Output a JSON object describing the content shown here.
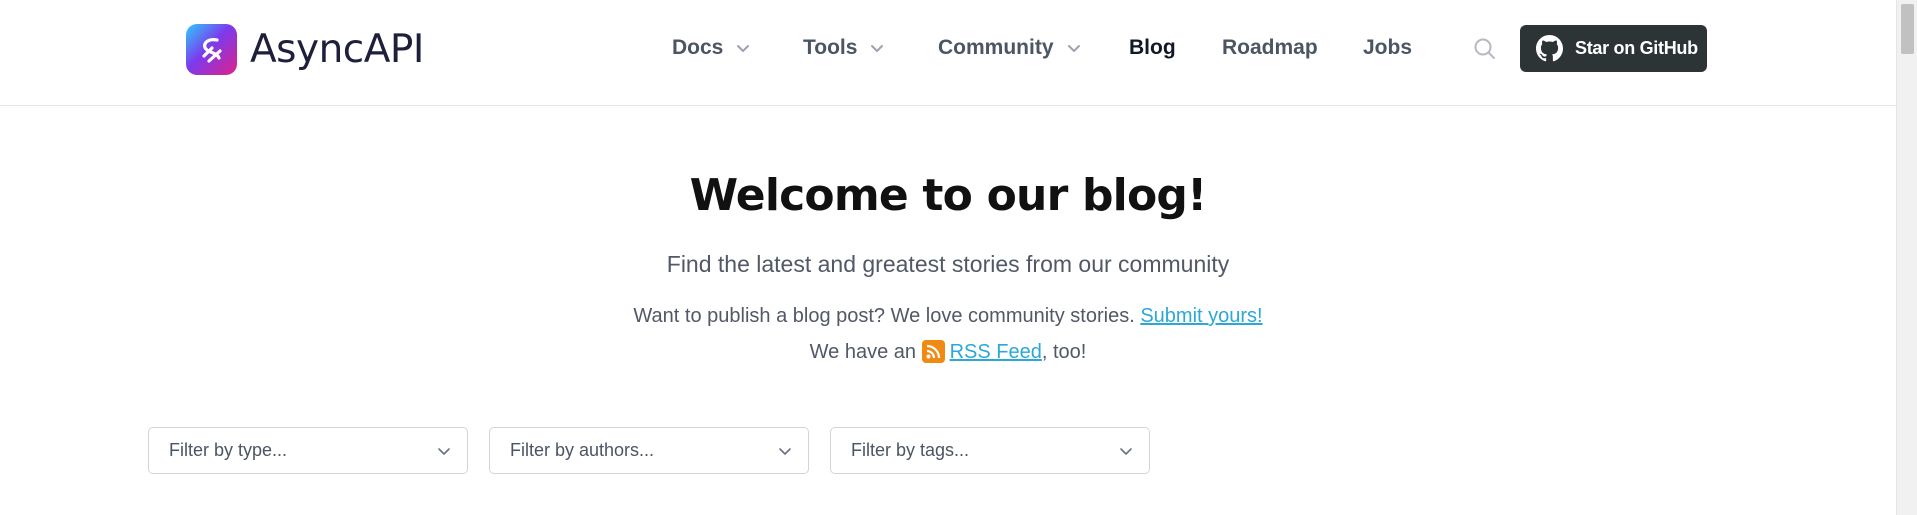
{
  "brand": {
    "name": "AsyncAPI"
  },
  "nav": {
    "items": [
      {
        "label": "Docs",
        "dropdown": true
      },
      {
        "label": "Tools",
        "dropdown": true
      },
      {
        "label": "Community",
        "dropdown": true
      },
      {
        "label": "Blog",
        "dropdown": false,
        "active": true
      },
      {
        "label": "Roadmap",
        "dropdown": false
      },
      {
        "label": "Jobs",
        "dropdown": false
      }
    ],
    "search_icon": "search-icon",
    "github_button": {
      "label": "Star on GitHub",
      "icon": "github-icon"
    }
  },
  "hero": {
    "title": "Welcome to our blog!",
    "subtitle": "Find the latest and greatest stories from our community",
    "publish_text": "Want to publish a blog post? We love community stories.",
    "submit_link": "Submit yours!",
    "rss_prefix": "We have an",
    "rss_link": "RSS Feed",
    "rss_suffix": ", too!"
  },
  "filters": {
    "type_placeholder": "Filter by type...",
    "authors_placeholder": "Filter by authors...",
    "tags_placeholder": "Filter by tags..."
  },
  "colors": {
    "github_button_bg": "#2d3436",
    "link": "#2ba8d6",
    "rss_orange": "#f08a13"
  }
}
